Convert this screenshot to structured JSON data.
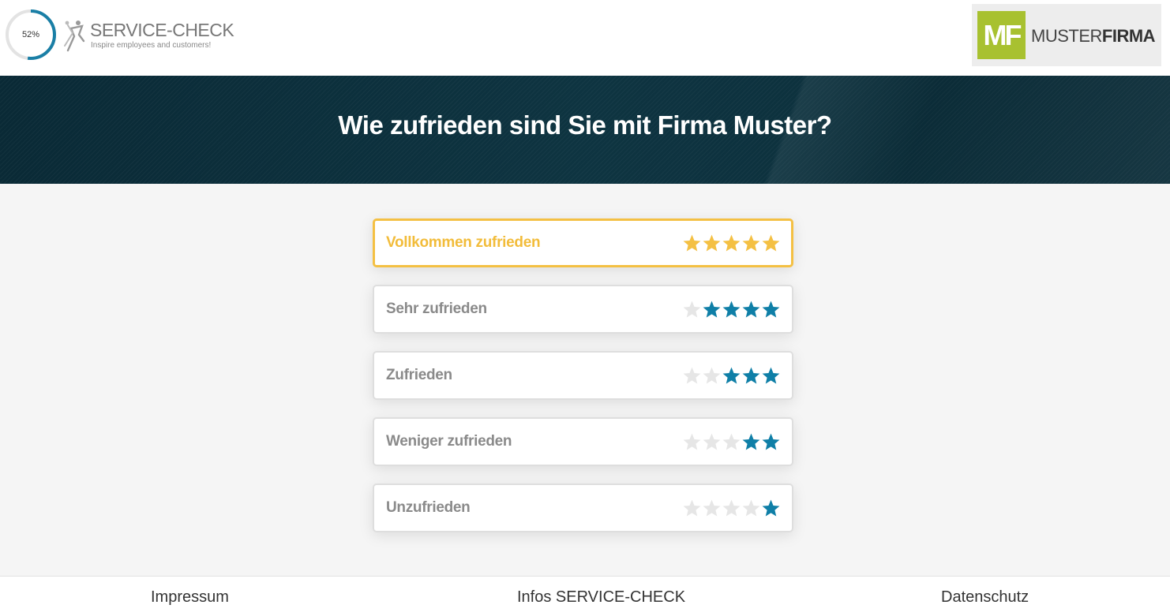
{
  "header": {
    "progress": {
      "percent": 52,
      "label": "52%",
      "color": "#1a7fa6",
      "track_color": "#e3e3e3"
    },
    "brand": {
      "title": "SERVICE-CHECK",
      "tagline": "Inspire employees and customers!"
    },
    "client": {
      "badge": "MF",
      "name_light": "MUSTER",
      "name_bold": "FIRMA",
      "badge_color": "#a8c130"
    }
  },
  "banner": {
    "question": "Wie zufrieden sind Sie mit Firma Muster?"
  },
  "options": [
    {
      "label": "Vollkommen zufrieden",
      "stars": 5,
      "selected": true
    },
    {
      "label": "Sehr zufrieden",
      "stars": 4,
      "selected": false
    },
    {
      "label": "Zufrieden",
      "stars": 3,
      "selected": false
    },
    {
      "label": "Weniger zufrieden",
      "stars": 2,
      "selected": false
    },
    {
      "label": "Unzufrieden",
      "stars": 1,
      "selected": false
    }
  ],
  "colors": {
    "star_selected": "#f4c043",
    "star_active": "#0f7fa7",
    "star_empty": "#e6e6e6"
  },
  "footer": {
    "links": [
      "Impressum",
      "Infos SERVICE-CHECK",
      "Datenschutz"
    ]
  }
}
